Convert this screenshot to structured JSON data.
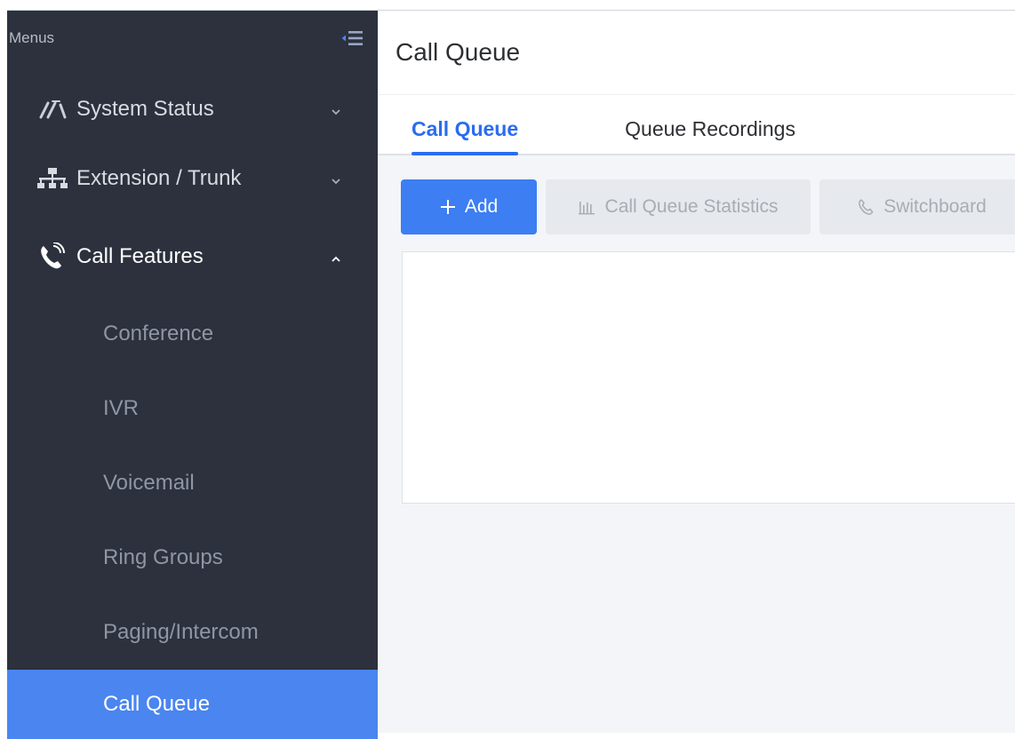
{
  "sidebar": {
    "menus_label": "Menus",
    "items": [
      {
        "label": "System Status",
        "icon": "gauge-icon",
        "expanded": false
      },
      {
        "label": "Extension / Trunk",
        "icon": "network-icon",
        "expanded": false
      },
      {
        "label": "Call Features",
        "icon": "phone-ring-icon",
        "expanded": true
      }
    ],
    "sub_items": [
      {
        "label": "Conference"
      },
      {
        "label": "IVR"
      },
      {
        "label": "Voicemail"
      },
      {
        "label": "Ring Groups"
      },
      {
        "label": "Paging/Intercom"
      },
      {
        "label": "Call Queue",
        "active": true
      }
    ]
  },
  "header": {
    "title": "Call Queue"
  },
  "tabs": [
    {
      "label": "Call Queue",
      "active": true
    },
    {
      "label": "Queue Recordings",
      "active": false
    }
  ],
  "toolbar": {
    "add_label": "Add",
    "stats_label": "Call Queue Statistics",
    "switchboard_label": "Switchboard"
  },
  "colors": {
    "sidebar_bg": "#2c313d",
    "accent": "#3d7ef2",
    "active_item": "#4a85f0"
  }
}
